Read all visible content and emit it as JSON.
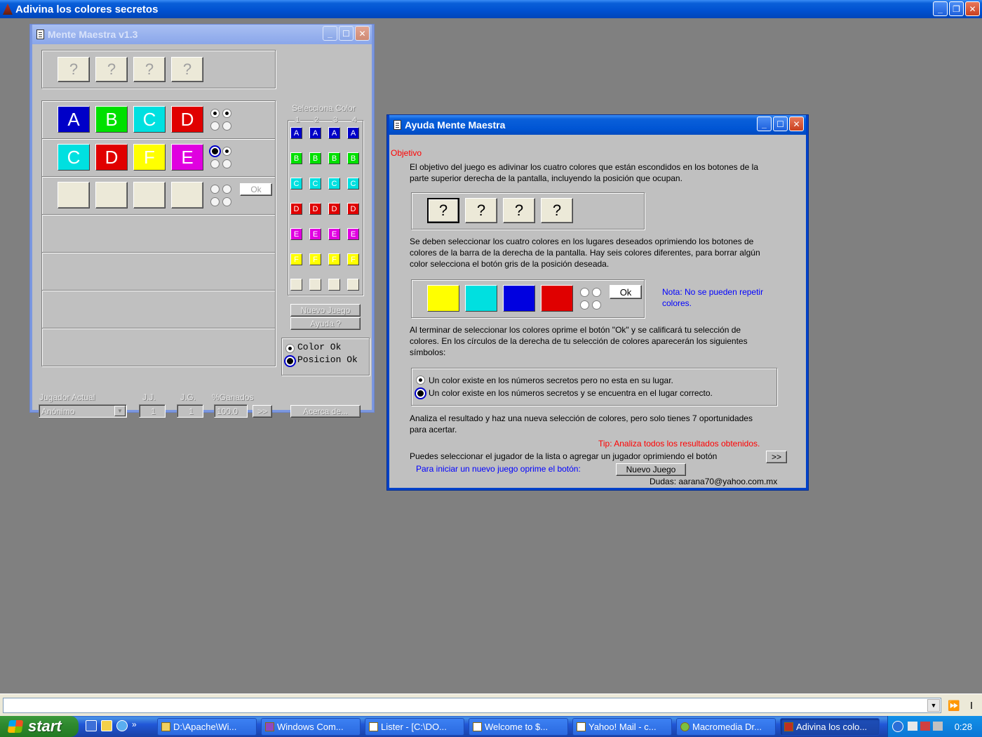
{
  "app": {
    "title": "Adivina los colores secretos"
  },
  "game": {
    "title": "Mente Maestra v1.3",
    "secret": [
      "?",
      "?",
      "?",
      "?"
    ],
    "rows": [
      {
        "slots": [
          "A",
          "B",
          "C",
          "D"
        ],
        "colors": [
          "#0000c8",
          "#00e000",
          "#00e0e0",
          "#e00000"
        ]
      },
      {
        "slots": [
          "C",
          "D",
          "F",
          "E"
        ],
        "colors": [
          "#00e0e0",
          "#e00000",
          "#ffff00",
          "#e000e0"
        ]
      }
    ],
    "ok_label": "Ok",
    "selector_title": "Selecciona Color",
    "selector_cols": [
      "1",
      "2",
      "3",
      "4"
    ],
    "selector_rows": [
      {
        "letter": "A",
        "color": "#0000c8"
      },
      {
        "letter": "B",
        "color": "#00e000"
      },
      {
        "letter": "C",
        "color": "#00e0e0"
      },
      {
        "letter": "D",
        "color": "#e00000"
      },
      {
        "letter": "E",
        "color": "#e000e0"
      },
      {
        "letter": "F",
        "color": "#ffff00"
      }
    ],
    "nuevo_juego": "Nuevo Juego",
    "ayuda": "Ayuda ?",
    "legend_color": "Color Ok",
    "legend_pos": "Posicion Ok",
    "jugador_label": "Jugador Actual",
    "jugador_value": "Anónimo",
    "jj_label": "J.J.",
    "jj_value": "1",
    "jg_label": "J.G.",
    "jg_value": "1",
    "ganados_label": "%Ganados",
    "ganados_value": "100.0",
    "more_label": ">>",
    "acerca": "Acerca de..."
  },
  "help": {
    "title": "Ayuda Mente Maestra",
    "heading": "Objetivo",
    "p1a": "El objetivo del juego es adivinar los cuatro colores que están escondidos en los botones de la",
    "p1b": "parte superior derecha de la pantalla, incluyendo la posición que ocupan.",
    "secret": [
      "?",
      "?",
      "?",
      "?"
    ],
    "p2a": "Se deben seleccionar los cuatro colores en los lugares deseados oprimiendo los botones de",
    "p2b": "colores de la barra de la derecha de la pantalla. Hay seis colores diferentes, para borrar algún",
    "p2c": "color selecciona el botón gris de la posición deseada.",
    "sample_colors": [
      "#ffff00",
      "#00e0e0",
      "#0000e0",
      "#e00000"
    ],
    "ok_label": "Ok",
    "nota": "Nota: No se pueden repetir colores.",
    "p3a": "Al terminar de seleccionar los colores oprime el botón \"Ok\" y se calificará tu selección de",
    "p3b": "colores. En los círculos de la derecha de tu selección de colores aparecerán los siguientes",
    "p3c": "símbolos:",
    "sym1": "Un color existe en los números secretos pero no esta en su lugar.",
    "sym2": "Un color existe en los números secretos y se encuentra en el lugar correcto.",
    "p4a": "Analiza el resultado y haz una nueva selección de colores, pero solo tienes 7 oportunidades",
    "p4b": "para acertar.",
    "tip": "Tip: Analiza todos los resultados obtenidos.",
    "p5": "Puedes seleccionar el jugador de la lista o agregar un jugador oprimiendo el botón",
    "more_label": ">>",
    "p6": "Para iniciar un nuevo juego oprime el botón:",
    "nuevo_juego": "Nuevo Juego",
    "dudas": "Dudas: aarana70@yahoo.com.mx"
  },
  "taskbar": {
    "start": "start",
    "quick_more": "»",
    "tasks": [
      "D:\\Apache\\Wi...",
      "Windows Com...",
      "Lister - [C:\\DO...",
      "Welcome to $...",
      "Yahoo! Mail - c...",
      "Macromedia Dr...",
      "Adivina los colo..."
    ],
    "clock": "0:28"
  },
  "colors": {
    "accent": "#0054e3",
    "face": "#c0c0c0",
    "nota": "#0000ff",
    "tip": "#ff0000"
  }
}
